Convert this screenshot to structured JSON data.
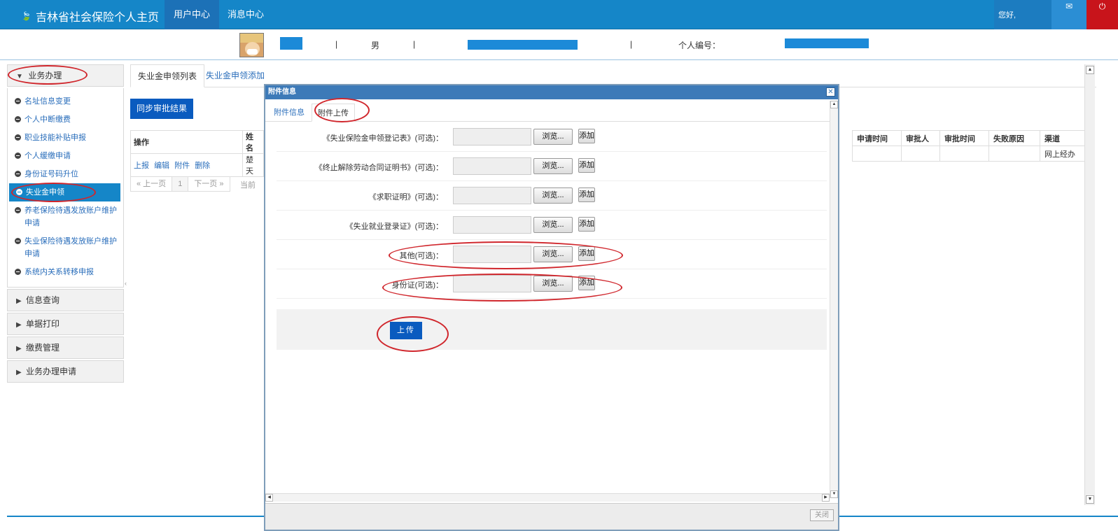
{
  "header": {
    "brand_title": "吉林省社会保险个人主页",
    "tabs": [
      "用户中心",
      "消息中心"
    ],
    "greeting": "您好,",
    "mail_icon_glyph": "✉",
    "power_icon_glyph": "⏻",
    "colors": {
      "bar": "#1586c8",
      "power": "#c8141b"
    }
  },
  "user_info": {
    "gender": "男",
    "separator": "|",
    "id_label": "个人编号："
  },
  "sidebar": {
    "open_section": "业务办理",
    "items": [
      "名址信息变更",
      "个人中断缴费",
      "职业技能补贴申报",
      "个人缓缴申请",
      "身份证号码升位",
      "失业金申领",
      "养老保险待遇发放账户维护申请",
      "失业保险待遇发放账户维护申请",
      "系统内关系转移申报"
    ],
    "active_item": "失业金申领",
    "collapsed_sections": [
      "信息查询",
      "单据打印",
      "缴费管理",
      "业务办理申请"
    ]
  },
  "main": {
    "tabs": [
      "失业金申领列表",
      "失业金申领添加"
    ],
    "sync_button": "同步审批结果",
    "table_left": {
      "headers": [
        "操作",
        "姓名"
      ],
      "row": {
        "actions": [
          "上报",
          "编辑",
          "附件",
          "删除"
        ],
        "name": "楚天"
      }
    },
    "table_right": {
      "headers": [
        "申请时间",
        "审批人",
        "审批时间",
        "失败原因",
        "渠道"
      ],
      "row": [
        "",
        "",
        "",
        "",
        "网上经办"
      ]
    },
    "pager": {
      "prev": "« 上一页",
      "page": "1",
      "next": "下一页 »",
      "tail": "当前"
    }
  },
  "modal": {
    "title": "附件信息",
    "close_glyph": "✕",
    "tabs": [
      "附件信息",
      "附件上传"
    ],
    "rows": [
      "《失业保险金申领登记表》(可选)：",
      "《终止解除劳动合同证明书》(可选)：",
      "《求职证明》(可选)：",
      "《失业就业登录证》(可选)：",
      "其他(可选)：",
      "身份证(可选)："
    ],
    "browse_label": "浏览...",
    "add_label": "添加",
    "upload_button": "上传",
    "close_button": "关闭"
  }
}
